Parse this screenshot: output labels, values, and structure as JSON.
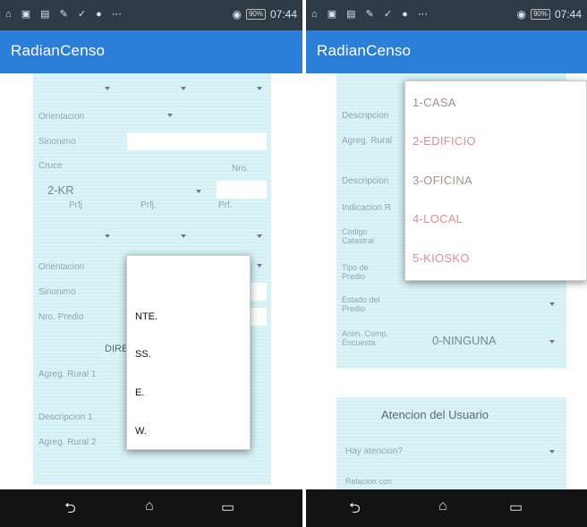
{
  "status": {
    "icons": "⌂ ▣ ▤ ✎ ✓ ● ⋯",
    "battery": "90%",
    "time": "07:44"
  },
  "app": {
    "title": "RadianCenso"
  },
  "left": {
    "orientacion1": "Orientacion",
    "sinonimo1": "Sinonimo",
    "cruce": "Cruce",
    "nro": "Nro.",
    "cruce_value": "2-KR",
    "prfj_labels": [
      "Prfj",
      "Prfj.",
      "Prf."
    ],
    "orientacion2": "Orientacion",
    "sinonimo2": "Sinonimo",
    "nro_predio": "Nro. Predio",
    "dir_header": "DIRE",
    "agreg_rural1": "Agreg. Rural 1",
    "descripcion1": "Descripcion 1",
    "agreg_rural2": "Agreg. Rural 2",
    "orientation_options": [
      "NTE.",
      "SS.",
      "E.",
      "W."
    ]
  },
  "right": {
    "descripcion": "Descripcion",
    "agreg_rural": "Agreg. Rural",
    "descripcion2": "Descripcion",
    "indicacion": "Indicacion R",
    "codigo_line1": "Codigo",
    "codigo_line2": "Catastral",
    "tipo_line1": "Tipo de",
    "tipo_line2": "Predio",
    "estado_line1": "Estado del",
    "estado_line2": "Predio",
    "anim_line1": "Anim. Comp.",
    "anim_line2": "Encuesta",
    "anim_value": "0-NINGUNA",
    "atencion_header": "Atencion del Usuario",
    "hay_atencion": "Hay atencion?",
    "relacion": "Relacion con",
    "menu_items": [
      "1-CASA",
      "2-EDIFICIO",
      "3-OFICINA",
      "4-LOCAL",
      "5-KIOSKO"
    ]
  },
  "nav": {
    "back": "⮌",
    "home": "⌂",
    "recent": "▭"
  }
}
